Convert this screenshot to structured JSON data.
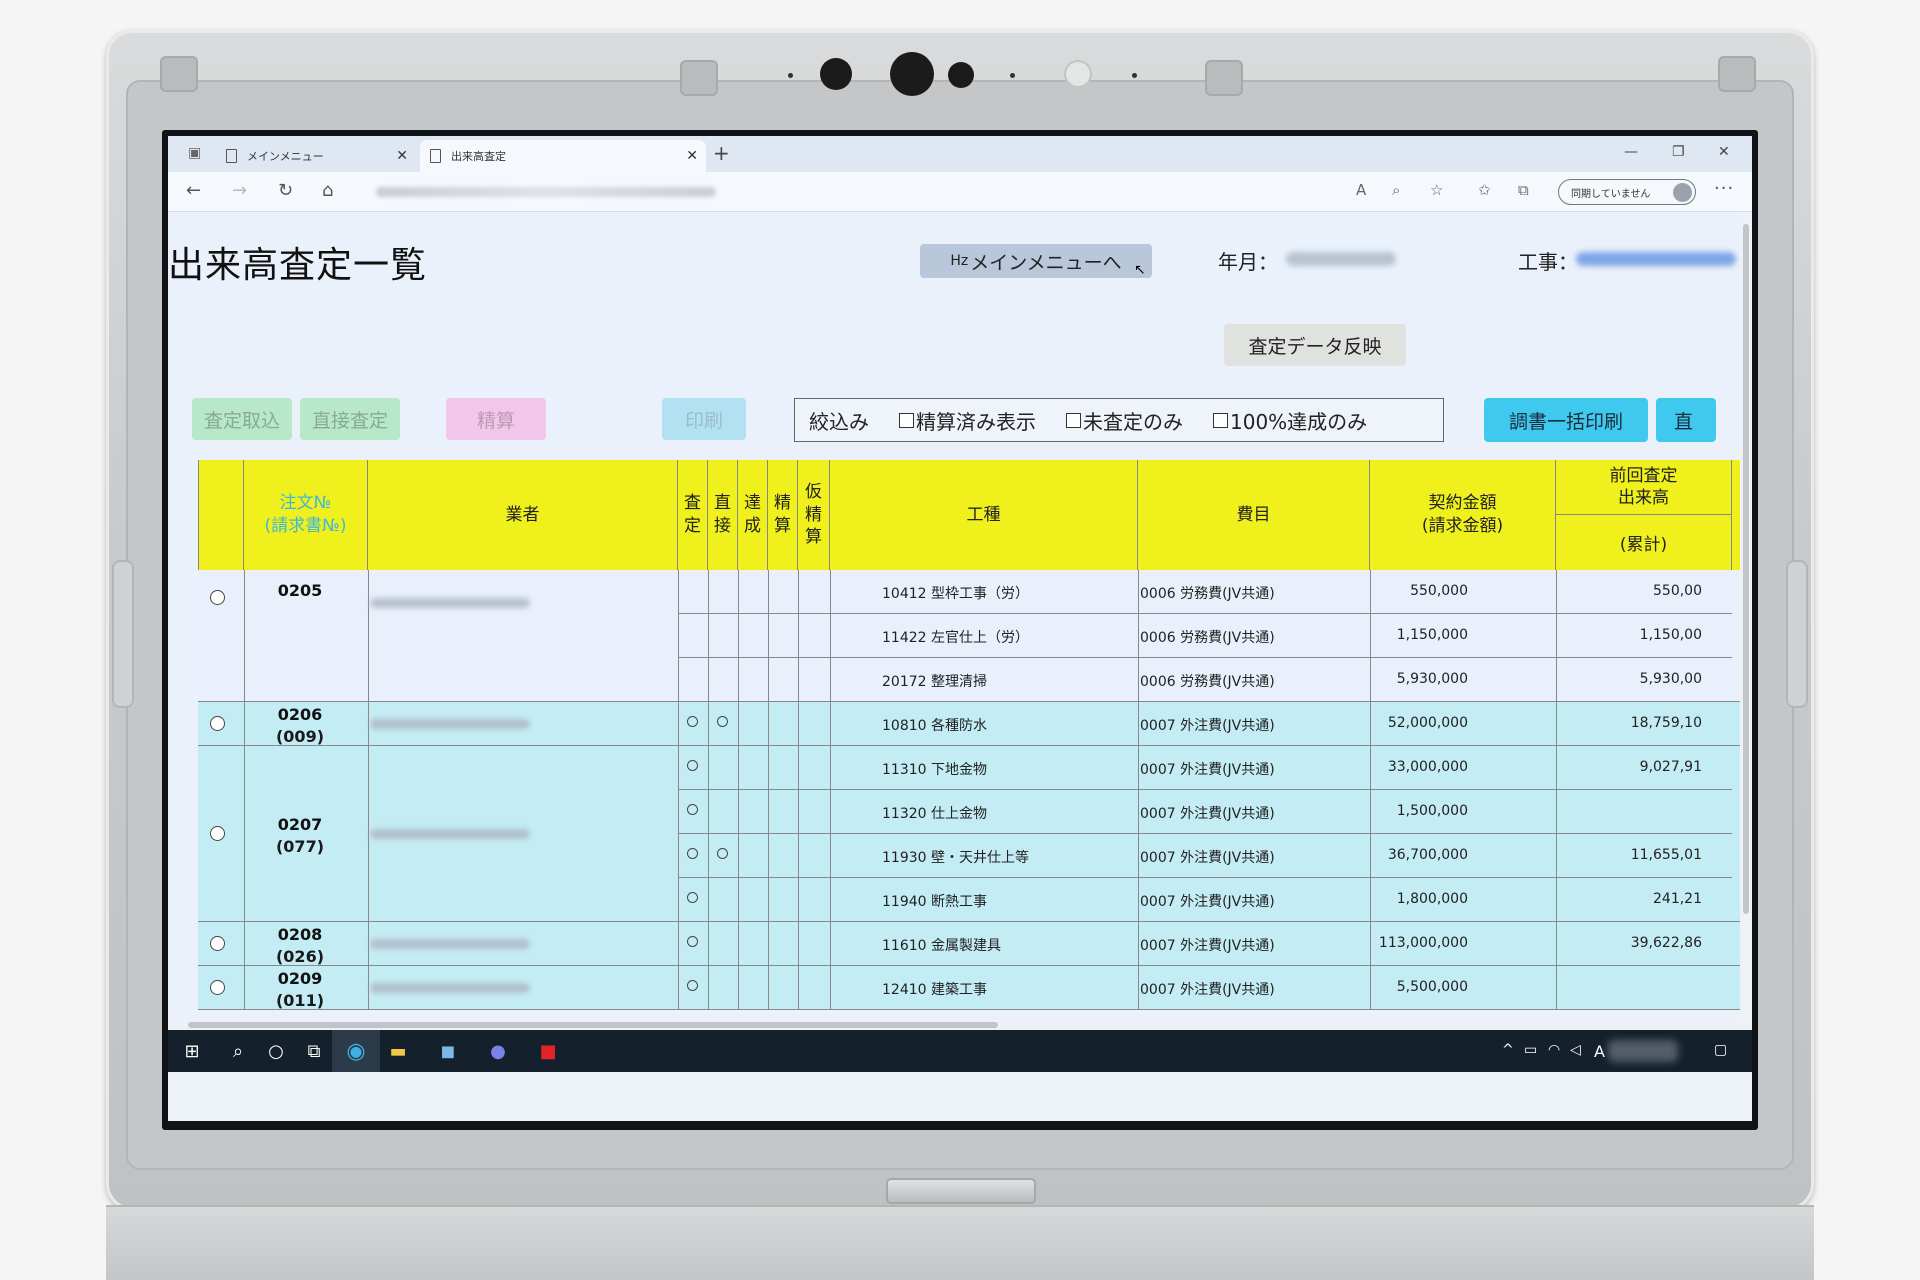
{
  "browser": {
    "tabs": [
      {
        "label": "メインメニュー"
      },
      {
        "label": "出来高査定"
      }
    ],
    "sync_label": "同期していません",
    "more": "···"
  },
  "page": {
    "title": "出来高査定一覧",
    "menu_button": "メインメニューへ",
    "menu_button_icon": "Hz",
    "year_month_label": "年月：",
    "project_label": "工事："
  },
  "toolbar": {
    "reflect": "査定データ反映",
    "take_in": "査定取込",
    "direct_assess": "直接査定",
    "settle": "精算",
    "print": "印刷",
    "filter_label": "絞込み",
    "filter_opt1": "精算済み表示",
    "filter_opt2": "未査定のみ",
    "filter_opt3": "100%達成のみ",
    "bulk_print": "調書一括印刷",
    "direct_short": "直"
  },
  "table": {
    "headers": {
      "order": "注文№",
      "order_sub": "(請求書№)",
      "vendor": "業者",
      "assess": [
        "査",
        "定"
      ],
      "direct": [
        "直",
        "接"
      ],
      "achieve": [
        "達",
        "成"
      ],
      "settle": [
        "精",
        "算"
      ],
      "provisional": [
        "仮",
        "精",
        "算"
      ],
      "work": "工種",
      "cost": "費目",
      "contract": "契約金額",
      "contract_sub": "(請求金額)",
      "prev_top1": "前回査定",
      "prev_top2": "出来高",
      "prev_bottom": "(累計)"
    },
    "groups": [
      {
        "order": "0205",
        "req": "",
        "rows": [
          {
            "work": "10412 型枠工事（労）",
            "cost": "0006 労務費(JV共通)",
            "amount": "550,000",
            "prev": "550,00"
          },
          {
            "work": "11422 左官仕上（労）",
            "cost": "0006 労務費(JV共通)",
            "amount": "1,150,000",
            "prev": "1,150,00"
          },
          {
            "work": "20172 整理清掃",
            "cost": "0006 労務費(JV共通)",
            "amount": "5,930,000",
            "prev": "5,930,00"
          }
        ]
      },
      {
        "order": "0206",
        "req": "(009)",
        "rows": [
          {
            "work": "10810 各種防水",
            "cost": "0007 外注費(JV共通)",
            "amount": "52,000,000",
            "prev": "18,759,10"
          }
        ]
      },
      {
        "order": "0207",
        "req": "(077)",
        "rows": [
          {
            "work": "11310 下地金物",
            "cost": "0007 外注費(JV共通)",
            "amount": "33,000,000",
            "prev": "9,027,91"
          },
          {
            "work": "11320 仕上金物",
            "cost": "0007 外注費(JV共通)",
            "amount": "1,500,000",
            "prev": ""
          },
          {
            "work": "11930 壁・天井仕上等",
            "cost": "0007 外注費(JV共通)",
            "amount": "36,700,000",
            "prev": "11,655,01"
          },
          {
            "work": "11940 断熱工事",
            "cost": "0007 外注費(JV共通)",
            "amount": "1,800,000",
            "prev": "241,21"
          }
        ]
      },
      {
        "order": "0208",
        "req": "(026)",
        "rows": [
          {
            "work": "11610 金属製建具",
            "cost": "0007 外注費(JV共通)",
            "amount": "113,000,000",
            "prev": "39,622,86"
          }
        ]
      },
      {
        "order": "0209",
        "req": "(011)",
        "rows": [
          {
            "work": "12410 建築工事",
            "cost": "0007 外注費(JV共通)",
            "amount": "5,500,000",
            "prev": ""
          }
        ]
      }
    ]
  },
  "colors": {
    "header_yellow": "#eff01c",
    "row_cyan": "#c4ecf5",
    "bulk_print_blue": "#40c9ef"
  }
}
